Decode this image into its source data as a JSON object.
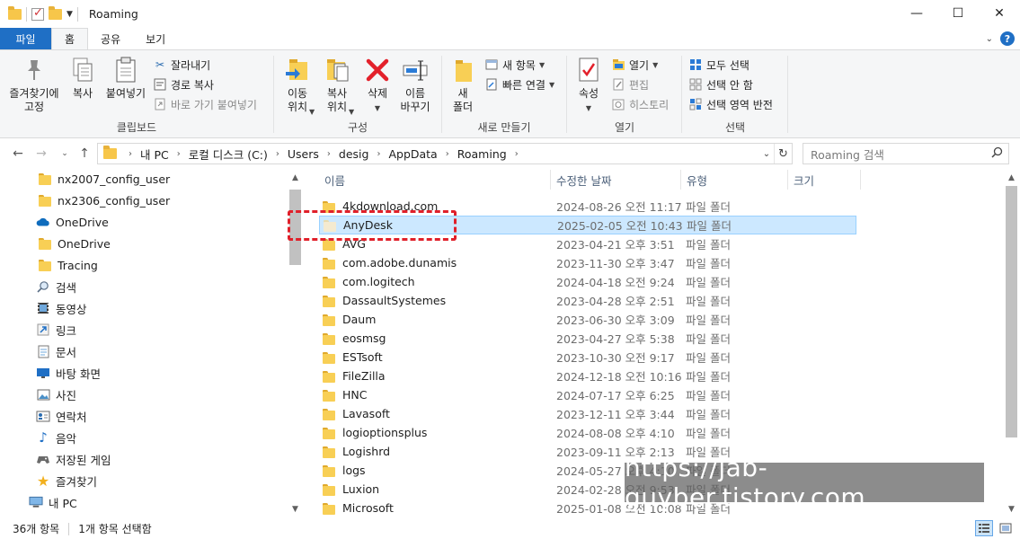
{
  "window": {
    "title": "Roaming",
    "controls": {
      "minimize": "—",
      "maximize": "☐",
      "close": "✕"
    }
  },
  "tabs": [
    {
      "label": "파일"
    },
    {
      "label": "홈"
    },
    {
      "label": "공유"
    },
    {
      "label": "보기"
    }
  ],
  "ribbon": {
    "clipboard": {
      "label": "클립보드",
      "pin": "즐겨찾기에\n고정",
      "copy": "복사",
      "paste": "붙여넣기",
      "cut": "잘라내기",
      "copy_path": "경로 복사",
      "paste_shortcut": "바로 가기 붙여넣기"
    },
    "organize": {
      "label": "구성",
      "move_to": "이동\n위치",
      "copy_to": "복사\n위치",
      "delete": "삭제",
      "rename": "이름\n바꾸기"
    },
    "new": {
      "label": "새로 만들기",
      "new_folder": "새\n폴더",
      "new_item": "새 항목",
      "easy_access": "빠른 연결"
    },
    "open": {
      "label": "열기",
      "properties": "속성",
      "open": "열기",
      "edit": "편집",
      "history": "히스토리"
    },
    "select": {
      "label": "선택",
      "select_all": "모두 선택",
      "select_none": "선택 안 함",
      "invert": "선택 영역 반전"
    }
  },
  "address": {
    "crumbs": [
      "내 PC",
      "로컬 디스크 (C:)",
      "Users",
      "desig",
      "AppData",
      "Roaming"
    ],
    "search_placeholder": "Roaming 검색"
  },
  "nav": {
    "items": [
      {
        "label": "nx2007_config_user",
        "icon": "folder-icon"
      },
      {
        "label": "nx2306_config_user",
        "icon": "folder-icon"
      },
      {
        "label": "OneDrive",
        "icon": "cloud-icon"
      },
      {
        "label": "OneDrive",
        "icon": "folder-icon"
      },
      {
        "label": "Tracing",
        "icon": "folder-icon"
      },
      {
        "label": "검색",
        "icon": "search-icon"
      },
      {
        "label": "동영상",
        "icon": "video-icon"
      },
      {
        "label": "링크",
        "icon": "link-icon"
      },
      {
        "label": "문서",
        "icon": "document-icon"
      },
      {
        "label": "바탕 화면",
        "icon": "desktop-icon"
      },
      {
        "label": "사진",
        "icon": "picture-icon"
      },
      {
        "label": "연락처",
        "icon": "contacts-icon"
      },
      {
        "label": "음악",
        "icon": "music-icon"
      },
      {
        "label": "저장된 게임",
        "icon": "game-icon"
      },
      {
        "label": "즐겨찾기",
        "icon": "star-icon"
      },
      {
        "label": "내 PC",
        "icon": "pc-icon"
      }
    ]
  },
  "columns": {
    "name": "이름",
    "date": "수정한 날짜",
    "type": "유형",
    "size": "크기"
  },
  "files": [
    {
      "name": "4kdownload.com",
      "date": "2024-08-26 오전 11:17",
      "type": "파일 폴더"
    },
    {
      "name": "AnyDesk",
      "date": "2025-02-05 오전 10:43",
      "type": "파일 폴더",
      "selected": true
    },
    {
      "name": "AVG",
      "date": "2023-04-21 오후 3:51",
      "type": "파일 폴더"
    },
    {
      "name": "com.adobe.dunamis",
      "date": "2023-11-30 오후 3:47",
      "type": "파일 폴더"
    },
    {
      "name": "com.logitech",
      "date": "2024-04-18 오전 9:24",
      "type": "파일 폴더"
    },
    {
      "name": "DassaultSystemes",
      "date": "2023-04-28 오후 2:51",
      "type": "파일 폴더"
    },
    {
      "name": "Daum",
      "date": "2023-06-30 오후 3:09",
      "type": "파일 폴더"
    },
    {
      "name": "eosmsg",
      "date": "2023-04-27 오후 5:38",
      "type": "파일 폴더"
    },
    {
      "name": "ESTsoft",
      "date": "2023-10-30 오전 9:17",
      "type": "파일 폴더"
    },
    {
      "name": "FileZilla",
      "date": "2024-12-18 오전 10:16",
      "type": "파일 폴더"
    },
    {
      "name": "HNC",
      "date": "2024-07-17 오후 6:25",
      "type": "파일 폴더"
    },
    {
      "name": "Lavasoft",
      "date": "2023-12-11 오후 3:44",
      "type": "파일 폴더"
    },
    {
      "name": "logioptionsplus",
      "date": "2024-08-08 오후 4:10",
      "type": "파일 폴더"
    },
    {
      "name": "Logishrd",
      "date": "2023-09-11 오후 2:13",
      "type": "파일 폴더"
    },
    {
      "name": "logs",
      "date": "2024-05-27 오후 4:10",
      "type": "파일 폴더"
    },
    {
      "name": "Luxion",
      "date": "2024-02-28 오전 9:53",
      "type": "파일 폴더"
    },
    {
      "name": "Microsoft",
      "date": "2025-01-08 오전 10:08",
      "type": "파일 폴더"
    }
  ],
  "status": {
    "count": "36개 항목",
    "selection": "1개 항목 선택함"
  },
  "watermark": "https://jab-guyber.tistory.com",
  "colors": {
    "accent": "#1f6fc5",
    "selection": "#cce8ff",
    "highlight": "#e0202a"
  }
}
